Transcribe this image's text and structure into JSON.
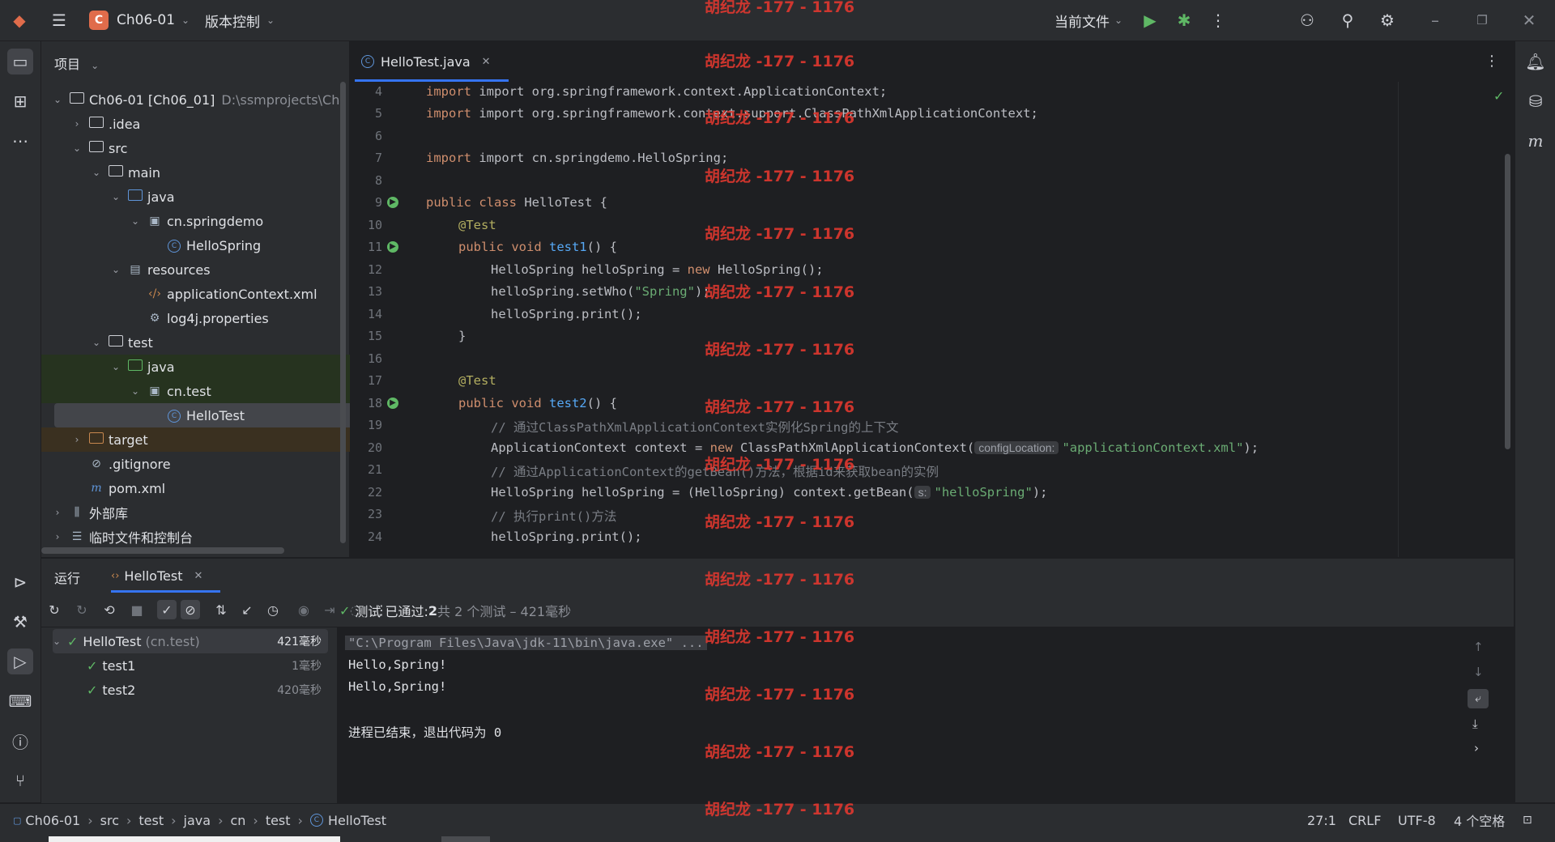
{
  "titlebar": {
    "project_badge": "C",
    "project_name": "Ch06-01",
    "vcs_label": "版本控制",
    "run_config": "当前文件"
  },
  "project_panel": {
    "title": "项目",
    "tree": [
      {
        "label": "Ch06-01 [Ch06_01]",
        "path": "D:\\ssmprojects\\Ch"
      },
      {
        "label": ".idea"
      },
      {
        "label": "src"
      },
      {
        "label": "main"
      },
      {
        "label": "java"
      },
      {
        "label": "cn.springdemo"
      },
      {
        "label": "HelloSpring"
      },
      {
        "label": "resources"
      },
      {
        "label": "applicationContext.xml"
      },
      {
        "label": "log4j.properties"
      },
      {
        "label": "test"
      },
      {
        "label": "java"
      },
      {
        "label": "cn.test"
      },
      {
        "label": "HelloTest"
      },
      {
        "label": "target"
      },
      {
        "label": ".gitignore"
      },
      {
        "label": "pom.xml"
      },
      {
        "label": "外部库"
      },
      {
        "label": "临时文件和控制台"
      }
    ]
  },
  "editor": {
    "tab_label": "HelloTest.java",
    "line_numbers": [
      "4",
      "5",
      "6",
      "7",
      "8",
      "9",
      "10",
      "11",
      "12",
      "13",
      "14",
      "15",
      "16",
      "17",
      "18",
      "19",
      "20",
      "21",
      "22",
      "23",
      "24"
    ],
    "code": {
      "l4": "import org.springframework.context.ApplicationContext;",
      "l5": "import org.springframework.context.support.ClassPathXmlApplicationContext;",
      "l7": "import cn.springdemo.HelloSpring;",
      "l9_kw": "public class ",
      "l9_name": "HelloTest {",
      "l10": "@Test",
      "l11_kw": "public void ",
      "l11_fn": "test1",
      "l11_rest": "() {",
      "l12_a": "HelloSpring helloSpring = ",
      "l12_kw": "new",
      "l12_b": " HelloSpring();",
      "l13_a": "helloSpring.setWho(",
      "l13_str": "\"Spring\"",
      "l13_b": ");",
      "l14": "helloSpring.print();",
      "l15": "}",
      "l17": "@Test",
      "l18_kw": "public void ",
      "l18_fn": "test2",
      "l18_rest": "() {",
      "l19": "// 通过ClassPathXmlApplicationContext实例化Spring的上下文",
      "l20_a": "ApplicationContext context = ",
      "l20_kw": "new",
      "l20_b": " ClassPathXmlApplicationContext(",
      "l20_hint": "configLocation:",
      "l20_str": "\"applicationContext.xml\"",
      "l20_c": ");",
      "l21": "// 通过ApplicationContext的getBean()方法，根据id来获取bean的实例",
      "l22_a": "HelloSpring helloSpring = (HelloSpring) context.getBean(",
      "l22_hint": "s:",
      "l22_str": "\"helloSpring\"",
      "l22_b": ");",
      "l23": "// 执行print()方法",
      "l24": "helloSpring.print();"
    }
  },
  "run_panel": {
    "tab_run": "运行",
    "tab_test": "HelloTest",
    "summary_a": "测试 已通过: ",
    "summary_b": "2",
    "summary_c": "共 2 个测试 – 421毫秒",
    "tests": [
      {
        "name": "HelloTest",
        "pkg": "(cn.test)",
        "time": "421毫秒"
      },
      {
        "name": "test1",
        "time": "1毫秒"
      },
      {
        "name": "test2",
        "time": "420毫秒"
      }
    ],
    "console": [
      "\"C:\\Program Files\\Java\\jdk-11\\bin\\java.exe\" ...",
      "Hello,Spring!",
      "Hello,Spring!",
      "",
      "进程已结束，退出代码为 0"
    ]
  },
  "statusbar": {
    "crumbs": [
      "Ch06-01",
      "src",
      "test",
      "java",
      "cn",
      "test",
      "HelloTest"
    ],
    "position": "27:1",
    "line_sep": "CRLF",
    "encoding": "UTF-8",
    "indent": "4 个空格"
  },
  "watermark": "胡纪龙 -177 - 1176",
  "colors": {
    "accent": "#3574f0",
    "success": "#5fb865",
    "badge": "#e06c4b"
  }
}
